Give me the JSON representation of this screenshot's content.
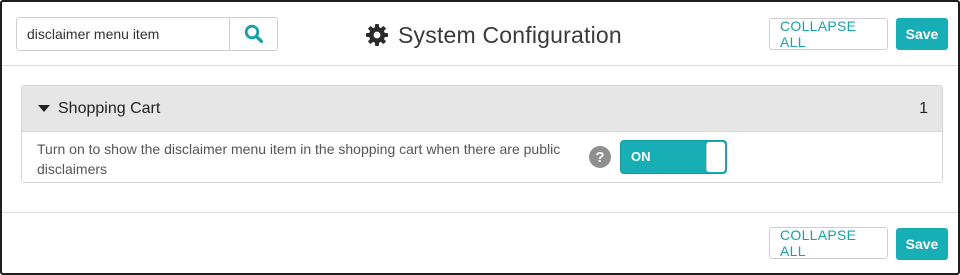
{
  "header": {
    "search_value": "disclaimer menu item",
    "title": "System Configuration",
    "collapse_all_label": "COLLAPSE ALL",
    "save_label": "Save"
  },
  "panel": {
    "title": "Shopping Cart",
    "count": "1",
    "setting": {
      "description": "Turn on to show the disclaimer menu item in the shopping cart when there are public disclaimers",
      "help_symbol": "?",
      "toggle_label": "ON",
      "toggle_on": true
    }
  },
  "footer": {
    "collapse_all_label": "COLLAPSE ALL",
    "save_label": "Save"
  },
  "colors": {
    "accent": "#17aeb6",
    "accent_text": "#17a0a8",
    "help_icon": "#8f8f8f"
  },
  "icons": {
    "search": "search-icon",
    "settings": "gear-icon",
    "collapse": "caret-down-icon",
    "help": "help-icon"
  }
}
